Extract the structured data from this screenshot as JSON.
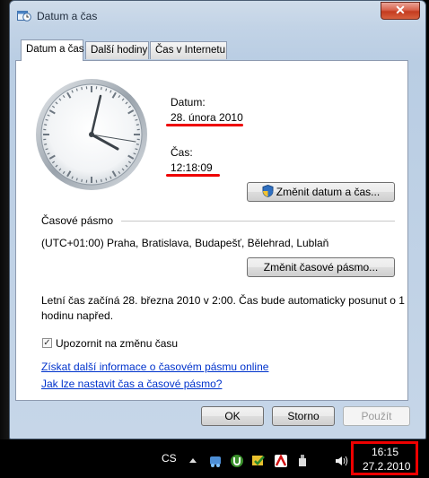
{
  "window": {
    "title": "Datum a čas",
    "close_glyph": "✕"
  },
  "tabs": [
    {
      "label": "Datum a čas",
      "active": true
    },
    {
      "label": "Další hodiny",
      "active": false
    },
    {
      "label": "Čas v Internetu",
      "active": false
    }
  ],
  "date_section": {
    "date_label": "Datum:",
    "date_value": "28. února 2010",
    "time_label": "Čas:",
    "time_value": "12:18:09",
    "change_button": "Změnit datum a čas..."
  },
  "timezone": {
    "heading": "Časové pásmo",
    "value": "(UTC+01:00) Praha, Bratislava, Budapešť, Bělehrad, Lublaň",
    "change_button": "Změnit časové pásmo...",
    "dst_line1": "Letní čas začíná 28. března 2010 v 2:00. Čas bude automaticky posunut o 1",
    "dst_line2": "hodinu napřed.",
    "notify_label": "Upozornit na změnu času",
    "notify_checked": true,
    "link1": "Získat další informace o časovém pásmu online",
    "link2": "Jak lze nastavit čas a časové pásmo?"
  },
  "buttons": {
    "ok": "OK",
    "cancel": "Storno",
    "apply": "Použít"
  },
  "taskbar": {
    "language": "CS",
    "clock_time": "16:15",
    "clock_date": "27.2.2010",
    "icons": [
      "show-hidden-arrow-icon",
      "network-tool-icon",
      "utorrent-icon",
      "security-check-icon",
      "antivirus-icon",
      "usb-device-icon",
      "volume-icon"
    ]
  },
  "colors": {
    "highlight_red": "#e00000",
    "link_blue": "#0033cc",
    "close_red": "#c43b1f"
  }
}
